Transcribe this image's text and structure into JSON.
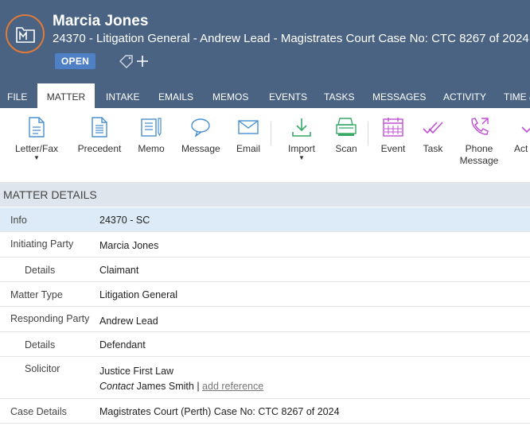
{
  "header": {
    "client_name": "Marcia Jones",
    "matter_description": "24370 - Litigation General - Andrew Lead - Magistrates Court Case No: CTC 8267 of 2024",
    "status": "OPEN",
    "icon": "matter-folder-icon"
  },
  "tabs": [
    {
      "label": "FILE"
    },
    {
      "label": "MATTER"
    },
    {
      "label": "INTAKE"
    },
    {
      "label": "EMAILS"
    },
    {
      "label": "MEMOS"
    },
    {
      "label": "EVENTS"
    },
    {
      "label": "TASKS"
    },
    {
      "label": "MESSAGES"
    },
    {
      "label": "ACTIVITY"
    },
    {
      "label": "TIME &"
    }
  ],
  "toolbar": {
    "letter_fax": "Letter/Fax",
    "precedent": "Precedent",
    "memo": "Memo",
    "message": "Message",
    "email": "Email",
    "import": "Import",
    "scan": "Scan",
    "event": "Event",
    "task": "Task",
    "phone_message_1": "Phone",
    "phone_message_2": "Message",
    "action_partial": "Act"
  },
  "details": {
    "section_title": "MATTER DETAILS",
    "rows": [
      {
        "label": "Info",
        "value": "24370 - SC"
      },
      {
        "label": "Initiating Party",
        "value": "Marcia Jones"
      },
      {
        "label": "Details",
        "value": "Claimant"
      },
      {
        "label": "Matter Type",
        "value": "Litigation General"
      },
      {
        "label": "Responding Party",
        "value": "Andrew Lead"
      },
      {
        "label": "Details",
        "value": "Defendant"
      },
      {
        "label": "Solicitor",
        "value": "Justice First Law",
        "contact_prefix": "Contact",
        "contact_name": "James Smith",
        "separator": "|",
        "add_reference": "add reference"
      },
      {
        "label": "Case Details",
        "value": "Magistrates Court (Perth) Case No: CTC 8267 of 2024"
      }
    ]
  },
  "colors": {
    "header_bg": "#4a6382",
    "accent_orange": "#e07a3a",
    "status_blue": "#4f7fc4",
    "icon_blue": "#4a8fd0",
    "icon_green": "#35a866",
    "icon_purple": "#c04fd6",
    "highlight_row": "#dcebf7"
  }
}
